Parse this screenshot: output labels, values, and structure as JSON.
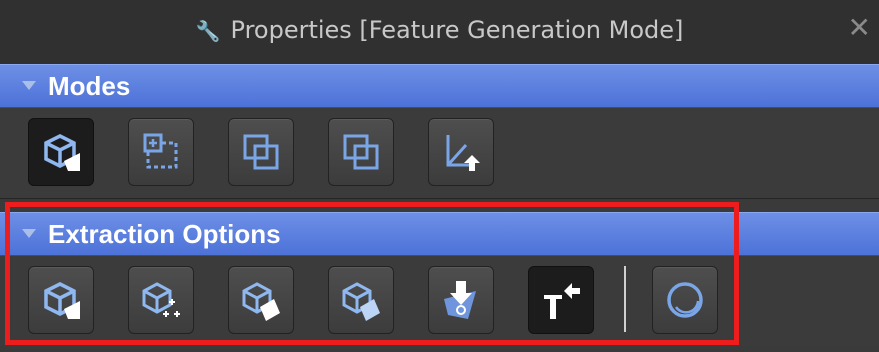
{
  "window": {
    "title": "Properties [Feature Generation Mode]",
    "title_icon": "wrench-icon",
    "close_glyph": "✕"
  },
  "sections": {
    "modes": {
      "label": "Modes",
      "tools": [
        {
          "icon": "cube-mode-icon",
          "selected": true
        },
        {
          "icon": "dashed-square-plus-icon",
          "selected": false
        },
        {
          "icon": "overlap-squares-icon",
          "selected": false
        },
        {
          "icon": "intersect-squares-icon",
          "selected": false
        },
        {
          "icon": "axis-arrow-icon",
          "selected": false
        }
      ]
    },
    "extraction": {
      "label": "Extraction Options",
      "tools": [
        {
          "icon": "cube-extract-icon",
          "selected": false
        },
        {
          "icon": "cube-points-icon",
          "selected": false
        },
        {
          "icon": "cube-surface-icon",
          "selected": false
        },
        {
          "icon": "cube-surface-light-icon",
          "selected": false
        },
        {
          "icon": "download-shape-icon",
          "selected": false
        },
        {
          "icon": "t-arrow-icon",
          "selected": true
        },
        {
          "icon": "circle-ring-icon",
          "selected": false
        }
      ]
    }
  },
  "colors": {
    "accent": "#6fa2e0",
    "section_bar": "#5a7de0",
    "highlight": "#ee1d1d"
  }
}
